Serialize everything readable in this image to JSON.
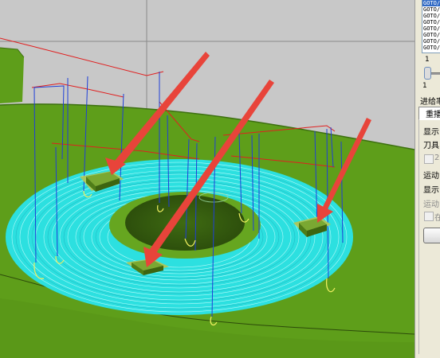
{
  "toolpath_list": {
    "items": [
      "GOTO/",
      "GOTO/",
      "GOTO/",
      "GOTO/",
      "GOTO/",
      "GOTO/",
      "GOTO/",
      "GOTO/"
    ],
    "selected_index": 0
  },
  "slider": {
    "max_label": "1",
    "min_label": "1"
  },
  "panel": {
    "feed_label": "进给率",
    "tab_label": "重播",
    "show_label": "显示",
    "tool_label": "刀具",
    "option1_label": "2",
    "motion_label": "运动",
    "show2_label": "显示",
    "motion2_label": "运动",
    "option2_label": "在"
  },
  "colors": {
    "toolpath_cyan": "#00f0f0",
    "retract_blue": "#1f3fd8",
    "rapid_red": "#e02020",
    "part_green": "#5e9e1a",
    "arrow_red": "#e8443a"
  }
}
